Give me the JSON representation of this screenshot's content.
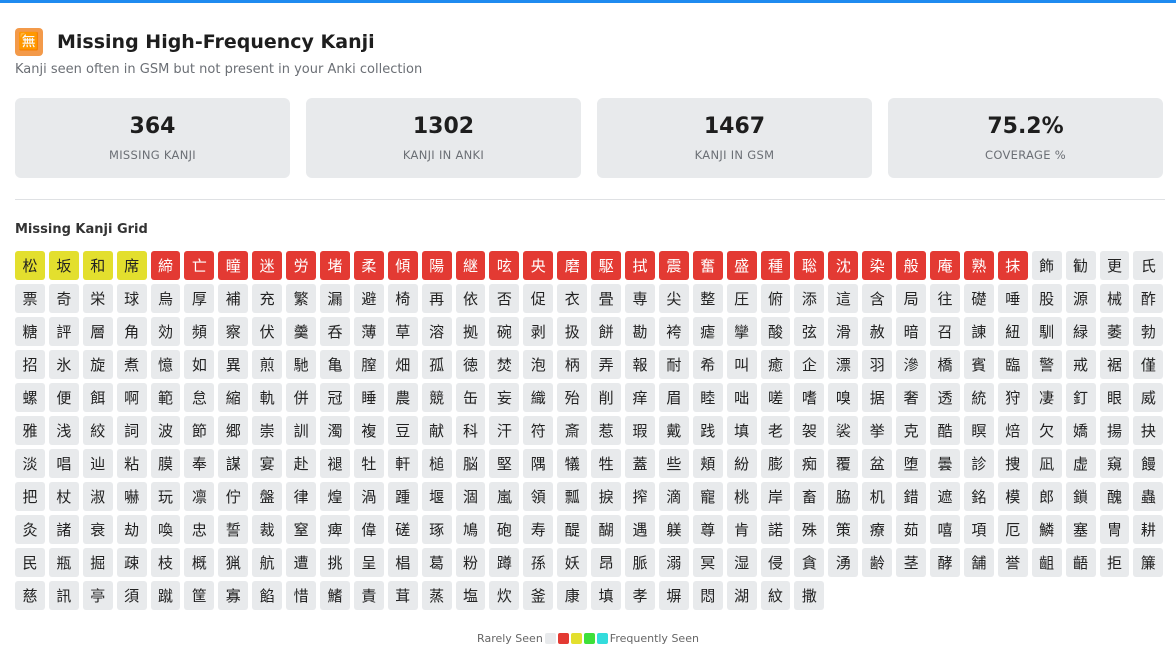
{
  "header": {
    "icon_glyph": "🈚",
    "icon_name": "missing-kanji-icon",
    "title": "Missing High-Frequency Kanji",
    "subtitle": "Kanji seen often in GSM but not present in your Anki collection"
  },
  "stats": [
    {
      "value": "364",
      "label": "MISSING KANJI"
    },
    {
      "value": "1302",
      "label": "KANJI IN ANKI"
    },
    {
      "value": "1467",
      "label": "KANJI IN GSM"
    },
    {
      "value": "75.2%",
      "label": "COVERAGE %"
    }
  ],
  "grid": {
    "title": "Missing Kanji Grid",
    "rows": [
      "松坂和席締亡瞳迷労堵柔傾陽継呟央磨駆拭震奮盛種聡沈染般庵熟抹飾勧更氏",
      "票奇栄球烏厚補充繁漏避椅再依否促衣畳専尖整圧俯添這含局往礎唾股源械酢",
      "糖評層角効頻察伏羹呑薄草溶拠碗剥扱餅勘袴瘧攣酸弦滑赦暗召諌紐馴緑萎勃",
      "招氷旋煮憶如異煎馳亀膣畑孤徳焚泡柄弄報耐希叫癒企漂羽滲橋賓臨警戒裾僅",
      "螺便餌啊範怠縮軌併冠睡農競缶妄織殆削痒眉睦咄嗟嗜嗅据奢透統狩凄釘眼威",
      "雅浅絞詞波節郷崇訓濁複豆献科汗符斎惹瑕戴践填老袈裟挙克酷瞑焙欠嬌揚抉",
      "淡唱辿粘膜奉謀宴赴褪牡軒槌脳堅隅犠牲蓋些頬紛膨痴覆盆堕曇診捜凪虚窺饅",
      "把杖淑嚇玩凛佇盤律煌渦踵堰涸嵐領瓢捩搾滴寵桃岸畜脇机錯遮銘模郎鎖醜蟲",
      "灸諸衰劫喚忠誓裁窒痺偉磋琢鳩砲寿醍醐遇躾尊肯諾殊策療茹嘻項厄鱗塞冑耕",
      "民瓶掘疎枝概猟航遭挑呈椙葛粉蹲孫妖昂脈溺冥湿侵貪湧齢茎酵舗誉齟齬拒簾",
      "慈訊亭須蹴筐寡餡惜鰭責茸蒸塩炊釜康填孝塀悶湖紋撒"
    ],
    "yellow_count": 4,
    "red_count": 26,
    "colors": {
      "default": "#e8eaec",
      "yellow": "#e3df2e",
      "red": "#e33a33"
    }
  },
  "legend": {
    "left_label": "Rarely Seen",
    "right_label": "Frequently Seen",
    "swatches": [
      "#e8eaec",
      "#e33a33",
      "#e3df2e",
      "#3ee03a",
      "#33dcdc"
    ]
  }
}
